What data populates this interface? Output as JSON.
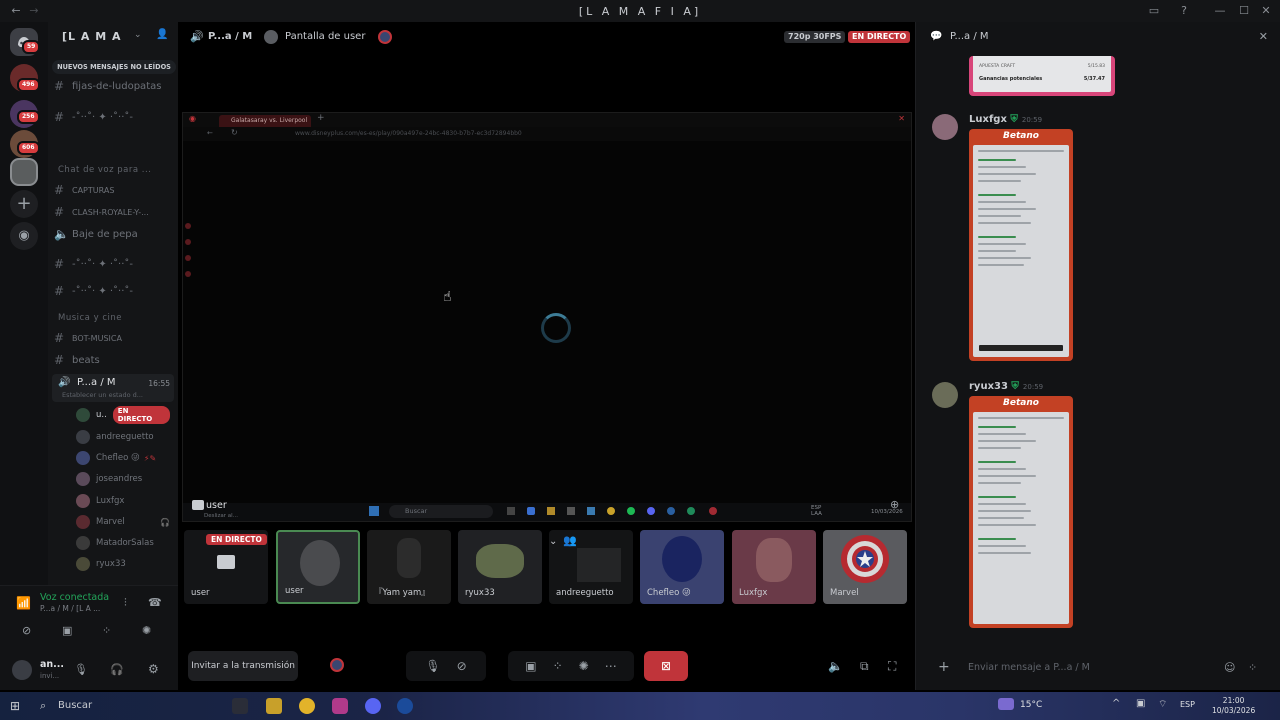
{
  "window": {
    "title": "[L A  M A F I A]"
  },
  "rail": {
    "badges": [
      "59",
      "496",
      "256",
      "606"
    ]
  },
  "server": {
    "name": "[L A  M A"
  },
  "channels": {
    "unread_banner": "NUEVOS MENSAJES NO LEÍDOS",
    "items": [
      {
        "label": "fijas-de-ludopatas"
      },
      {
        "label": "-˚··˚‧ ✦ ‧˚··˚-"
      },
      {
        "label": "Chat de voz para ..."
      },
      {
        "label": "CAPTURAS"
      },
      {
        "label": "CLASH-ROYALE-Y-..."
      },
      {
        "label": "Baje de pepa"
      },
      {
        "label": "-˚··˚‧ ✦ ‧˚··˚-"
      },
      {
        "label": "-˚··˚‧ ✦ ‧˚··˚-"
      },
      {
        "label": "Musica y cine"
      },
      {
        "label": "BOT-MUSICA"
      },
      {
        "label": "beats"
      }
    ],
    "active_voice": {
      "name": "P...a / M",
      "time": "16:55",
      "status": "Establecer un estado d..."
    },
    "voice_users": [
      {
        "name": "u..",
        "live": "EN DIRECTO"
      },
      {
        "name": "andreeguetto"
      },
      {
        "name": "Chefleo 😜"
      },
      {
        "name": "joseandres"
      },
      {
        "name": "Luxfgx"
      },
      {
        "name": "Marvel"
      },
      {
        "name": "MatadorSalas"
      },
      {
        "name": "ryux33"
      }
    ]
  },
  "voice_panel": {
    "title": "Voz conectada",
    "sub": "P...a / M / [L A ...",
    "user_name": "an...",
    "user_status": "invi..."
  },
  "stage": {
    "channel": "P...a / M",
    "screen_label": "Pantalla de user",
    "quality": "720p 30FPS",
    "live": "EN DIRECTO",
    "browser": {
      "tab": "Galatasaray vs. Liverpool",
      "url": "www.disneyplus.com/es-es/play/090a497e-24bc-4830-b7b7-ec3d72894bb0",
      "loading": true
    },
    "streamer_label": "user",
    "streamer_sub": "Deslizar al...",
    "inner_taskbar": {
      "search": "Buscar",
      "lang": "ESP",
      "lang2": "LAA",
      "date": "10/03/2026"
    }
  },
  "tiles": [
    {
      "name": "user",
      "live": "EN DIRECTO"
    },
    {
      "name": "user"
    },
    {
      "name": "『Yam yam』"
    },
    {
      "name": "ryux33"
    },
    {
      "name": "andreeguetto"
    },
    {
      "name": "Chefleo 😜"
    },
    {
      "name": "Luxfgx"
    },
    {
      "name": "Marvel"
    }
  ],
  "controls": {
    "invite": "Invitar a la transmisión"
  },
  "chat": {
    "channel": "P...a / M",
    "messages": [
      {
        "user": "Luxfgx",
        "time": "20:59"
      },
      {
        "user": "ryux33",
        "time": "20:59"
      }
    ],
    "betano_brand": "Betano",
    "top_card": {
      "line1": "APUESTA CRAFT",
      "line1_value": "5/15.83",
      "line2": "Ganancias potenciales",
      "line2_value": "5/37.47"
    },
    "input_placeholder": "Enviar mensaje a P...a / M"
  },
  "taskbar": {
    "search": "Buscar",
    "weather": "15°C",
    "lang": "ESP",
    "time": "21:00",
    "date": "10/03/2026"
  },
  "colors": {
    "live": "#c0343a",
    "betano": "#c34124",
    "accent": "#5865f2",
    "green": "#23a55a"
  }
}
